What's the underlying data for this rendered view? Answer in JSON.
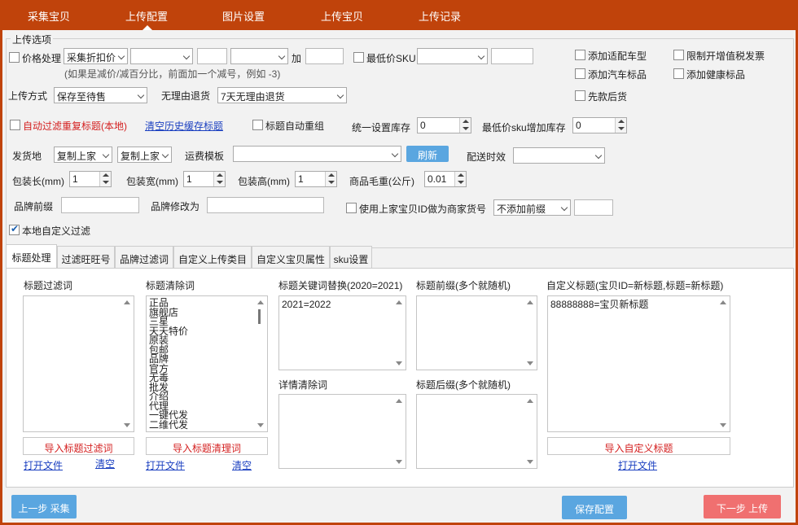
{
  "nav": {
    "items": [
      "采集宝贝",
      "上传配置",
      "图片设置",
      "上传宝贝",
      "上传记录"
    ]
  },
  "colors": {
    "accent": "#c0430b",
    "button_blue": "#5aa6e0",
    "button_red": "#f07070",
    "link": "#1a3fc0"
  },
  "upload_options": {
    "legend": "上传选项",
    "price": {
      "label": "价格处理",
      "mode_select": "采集折扣价",
      "select2": "",
      "input1": "",
      "select3": "",
      "add_label": "加",
      "add_value": "",
      "hint": "(如果是减价/减百分比，前面加一个减号，例如 -3)"
    },
    "lowest_sku": {
      "label": "最低价SKU",
      "select": "",
      "value": ""
    },
    "right_checks": {
      "add_car_model": "添加适配车型",
      "limit_vat_invoice": "限制开增值税发票",
      "add_car_tag": "添加汽车标品",
      "add_health_tag": "添加健康标品",
      "pay_first": "先款后货"
    },
    "upload_mode": {
      "label": "上传方式",
      "value": "保存至待售"
    },
    "no_reason_return": {
      "label": "无理由退货",
      "value": "7天无理由退货"
    },
    "auto_filter_dup": "自动过滤重复标题(本地)",
    "clear_cache_link": "清空历史缓存标题",
    "auto_dedup_title": "标题自动重组",
    "unify_stock": {
      "label": "统一设置库存",
      "value": "0"
    },
    "min_sku_stock": {
      "label": "最低价sku增加库存",
      "value": "0"
    },
    "ship_from": {
      "label": "发货地",
      "select1": "复制上家",
      "select2": "复制上家"
    },
    "freight": {
      "label": "运费模板",
      "value": "",
      "refresh": "刷新"
    },
    "delivery_time": {
      "label": "配送时效",
      "value": ""
    },
    "pack_length": {
      "label": "包装长(mm)",
      "value": "1"
    },
    "pack_width": {
      "label": "包装宽(mm)",
      "value": "1"
    },
    "pack_height": {
      "label": "包装高(mm)",
      "value": "1"
    },
    "gross_weight": {
      "label": "商品毛重(公斤)",
      "value": "0.01"
    },
    "brand_prefix": {
      "label": "品牌前缀",
      "value": ""
    },
    "brand_change": {
      "label": "品牌修改为",
      "value": ""
    },
    "use_id_as_code": {
      "label": "使用上家宝贝ID做为商家货号",
      "select": "不添加前缀",
      "value": ""
    },
    "local_custom_filter": "本地自定义过滤"
  },
  "tabs": [
    "标题处理",
    "过滤旺旺号",
    "品牌过滤词",
    "自定义上传类目",
    "自定义宝贝属性",
    "sku设置"
  ],
  "title_panel": {
    "filter_words": {
      "label": "标题过滤词",
      "items": [],
      "import_btn": "导入标题过滤词",
      "open": "打开文件",
      "clear": "清空"
    },
    "clean_words": {
      "label": "标题清除词",
      "items": [
        "正品",
        "旗舰店",
        "三星",
        "天天特价",
        "原装",
        "包邮",
        "品牌",
        "官方",
        "无毒",
        "批发",
        "介绍",
        "代理",
        "一键代发",
        "二维代发"
      ],
      "import_btn": "导入标题清理词",
      "open": "打开文件",
      "clear": "清空"
    },
    "keyword_replace": {
      "label": "标题关键词替换(2020=2021)",
      "items": [
        "2021=2022"
      ]
    },
    "detail_clean": {
      "label": "详情清除词",
      "items": []
    },
    "title_prefix": {
      "label": "标题前缀(多个就随机)",
      "items": []
    },
    "title_suffix": {
      "label": "标题后缀(多个就随机)",
      "items": []
    },
    "custom_title": {
      "label": "自定义标题(宝贝ID=新标题,标题=新标题)",
      "items": [
        "88888888=宝贝新标题"
      ],
      "import_btn": "导入自定义标题",
      "open": "打开文件"
    }
  },
  "footer": {
    "prev": "上一步 采集",
    "save": "保存配置",
    "next": "下一步 上传"
  }
}
